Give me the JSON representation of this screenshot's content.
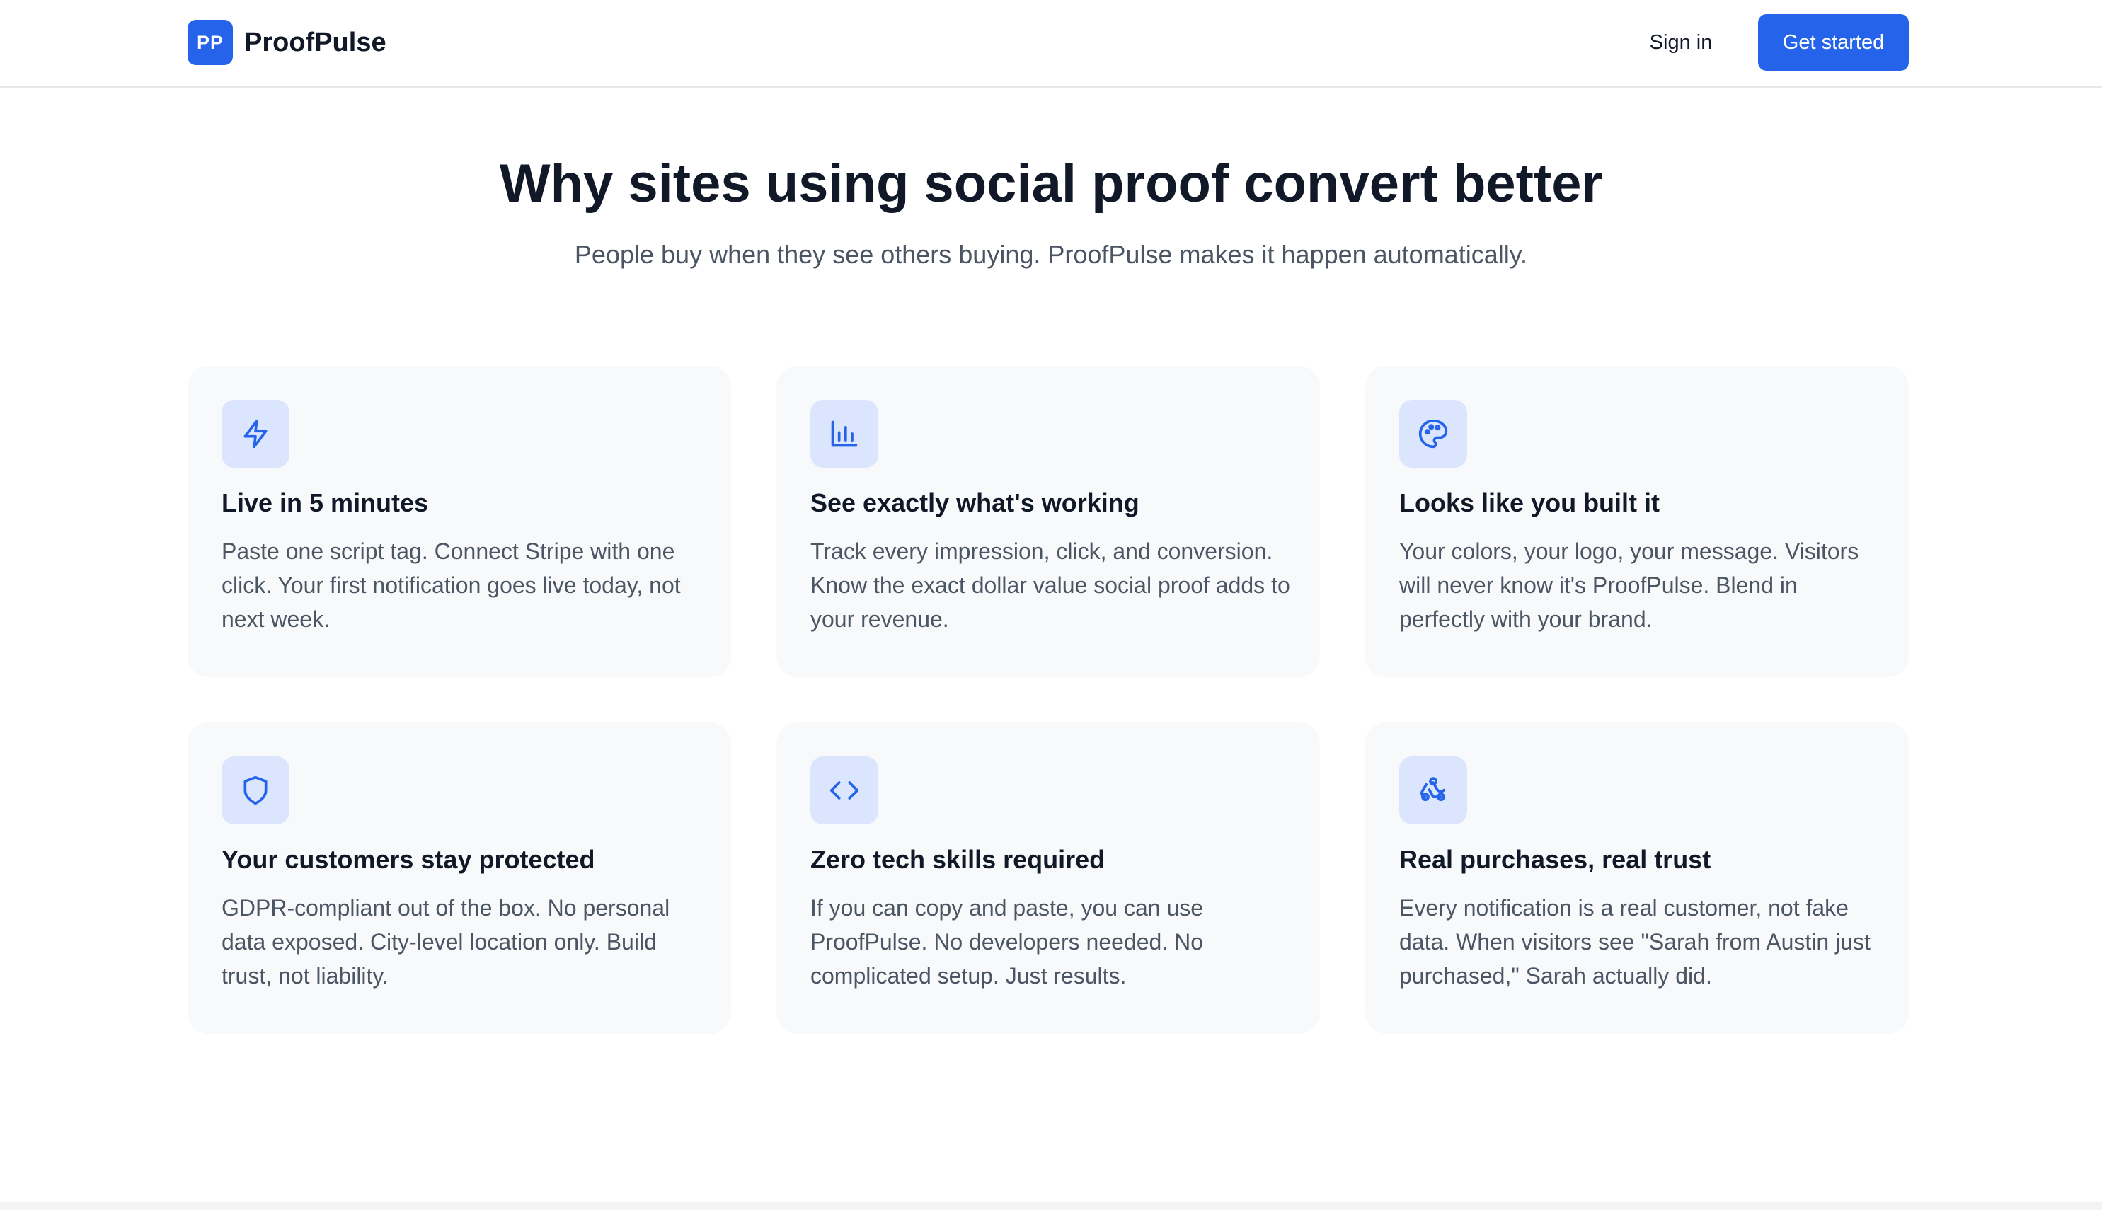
{
  "header": {
    "logo_initials": "PP",
    "brand_name": "ProofPulse",
    "sign_in_label": "Sign in",
    "get_started_label": "Get started"
  },
  "hero": {
    "title": "Why sites using social proof convert better",
    "subtitle": "People buy when they see others buying. ProofPulse makes it happen automatically."
  },
  "features": [
    {
      "icon": "lightning-icon",
      "title": "Live in 5 minutes",
      "description": "Paste one script tag. Connect Stripe with one click. Your first notification goes live today, not next week."
    },
    {
      "icon": "bar-chart-icon",
      "title": "See exactly what's working",
      "description": "Track every impression, click, and conversion. Know the exact dollar value social proof adds to your revenue."
    },
    {
      "icon": "palette-icon",
      "title": "Looks like you built it",
      "description": "Your colors, your logo, your message. Visitors will never know it's ProofPulse. Blend in perfectly with your brand."
    },
    {
      "icon": "shield-icon",
      "title": "Your customers stay protected",
      "description": "GDPR-compliant out of the box. No personal data exposed. City-level location only. Build trust, not liability."
    },
    {
      "icon": "code-icon",
      "title": "Zero tech skills required",
      "description": "If you can copy and paste, you can use ProofPulse. No developers needed. No complicated setup. Just results."
    },
    {
      "icon": "webhook-icon",
      "title": "Real purchases, real trust",
      "description": "Every notification is a real customer, not fake data. When visitors see \"Sarah from Austin just purchased,\" Sarah actually did."
    }
  ],
  "colors": {
    "accent": "#2563eb",
    "icon_bg": "#dbe5fd",
    "card_bg": "#f8f9fb",
    "heading": "#111827",
    "body_text": "#4b5563"
  }
}
